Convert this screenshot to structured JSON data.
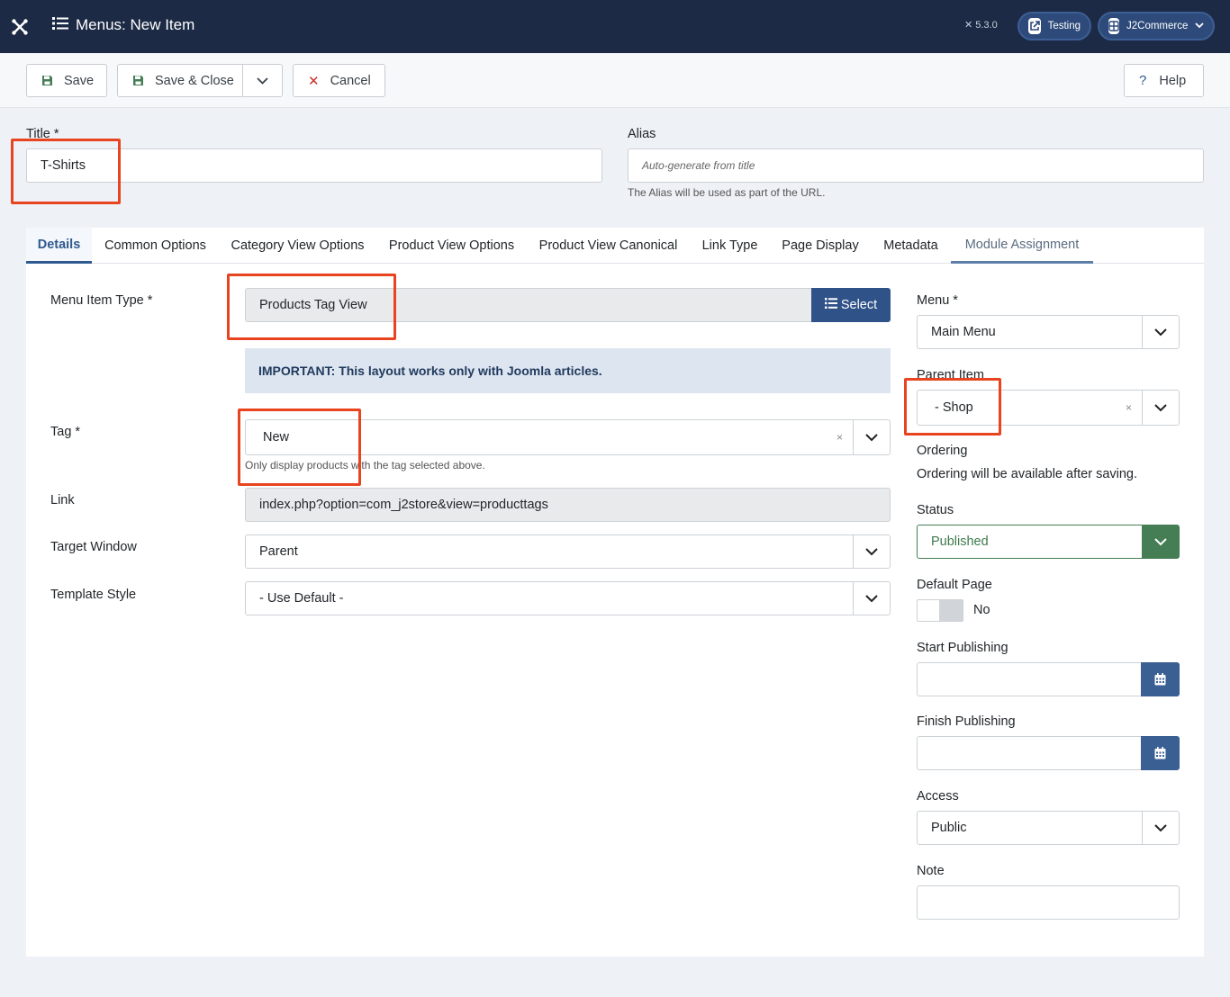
{
  "header": {
    "title": "Menus: New Item",
    "version": "5.3.0",
    "site_pill": "Testing",
    "user_pill": "J2Commerce"
  },
  "toolbar": {
    "save": "Save",
    "save_close": "Save & Close",
    "cancel": "Cancel",
    "help": "Help"
  },
  "form": {
    "title_label": "Title *",
    "title_value": "T-Shirts",
    "alias_label": "Alias",
    "alias_placeholder": "Auto-generate from title",
    "alias_hint": "The Alias will be used as part of the URL."
  },
  "tabs": [
    "Details",
    "Common Options",
    "Category View Options",
    "Product View Options",
    "Product View Canonical",
    "Link Type",
    "Page Display",
    "Metadata",
    "Module Assignment"
  ],
  "details": {
    "menu_item_type_label": "Menu Item Type *",
    "menu_item_type_value": "Products Tag View",
    "select_button": "Select",
    "important_note": "IMPORTANT: This layout works only with Joomla articles.",
    "tag_label": "Tag *",
    "tag_value": "New",
    "tag_hint": "Only display products with the tag selected above.",
    "link_label": "Link",
    "link_value": "index.php?option=com_j2store&view=producttags",
    "target_label": "Target Window",
    "target_value": "Parent",
    "template_label": "Template Style",
    "template_value": "- Use Default -"
  },
  "sidebar": {
    "menu_label": "Menu *",
    "menu_value": "Main Menu",
    "parent_label": "Parent Item",
    "parent_value": "- Shop",
    "ordering_label": "Ordering",
    "ordering_text": "Ordering will be available after saving.",
    "status_label": "Status",
    "status_value": "Published",
    "default_label": "Default Page",
    "default_value": "No",
    "start_label": "Start Publishing",
    "finish_label": "Finish Publishing",
    "access_label": "Access",
    "access_value": "Public",
    "note_label": "Note"
  },
  "colors": {
    "header_bg": "#1c2a45",
    "accent": "#2e5a8f",
    "select_btn": "#2f5288",
    "status_green": "#457d54",
    "highlight": "#e8441f"
  }
}
